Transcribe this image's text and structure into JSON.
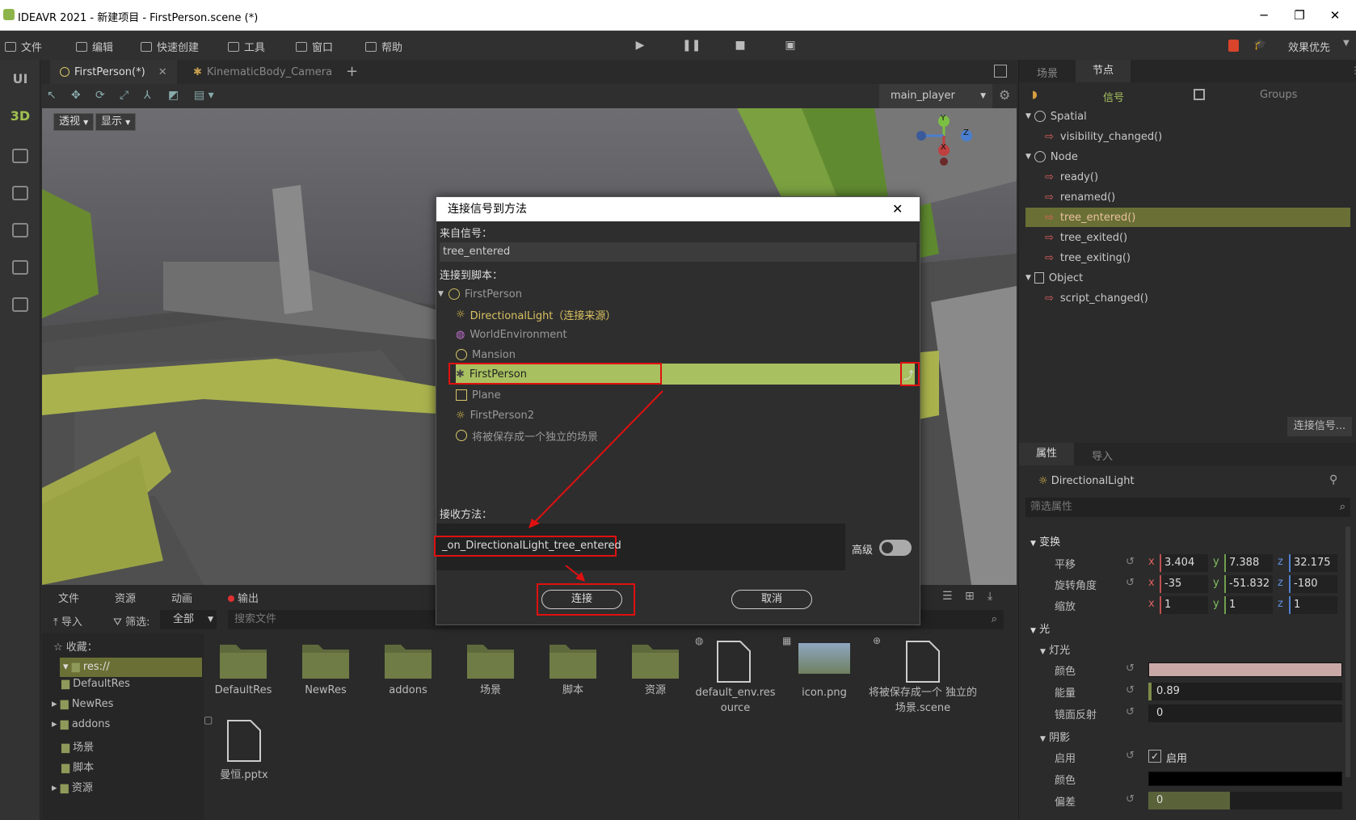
{
  "window": {
    "title": "IDEAVR 2021 - 新建项目 - FirstPerson.scene (*)",
    "controls": [
      "─",
      "❐",
      "✕"
    ]
  },
  "menubar": {
    "items": [
      "文件",
      "编辑",
      "快速创建",
      "工具",
      "窗口",
      "帮助"
    ],
    "perf_label": "效果优先"
  },
  "leftbar": {
    "ui_label": "UI",
    "d3_label": "3D"
  },
  "tabs": [
    {
      "label": "FirstPerson(*)",
      "close": "✕"
    },
    {
      "label": "KinematicBody_Camera"
    }
  ],
  "tabs_add": "+",
  "toolbar3d": {
    "camera_select": "main_player"
  },
  "viewport": {
    "view_btn": "透视",
    "show_btn": "显示",
    "gizmo": {
      "y": "Y",
      "z": "Z",
      "x": "X"
    }
  },
  "bottom_dock": {
    "tabs": [
      "文件",
      "资源",
      "动画",
      "输出"
    ],
    "import_label": "导入",
    "filter_label": "筛选:",
    "filter_value": "全部",
    "search_placeholder": "搜索文件",
    "favorites_label": "收藏：",
    "tree": [
      "res://",
      "DefaultRes",
      "NewRes",
      "addons",
      "场景",
      "脚本",
      "资源"
    ],
    "files": [
      {
        "label": "DefaultRes",
        "kind": "folder"
      },
      {
        "label": "NewRes",
        "kind": "folder"
      },
      {
        "label": "addons",
        "kind": "folder"
      },
      {
        "label": "场景",
        "kind": "folder"
      },
      {
        "label": "脚本",
        "kind": "folder"
      },
      {
        "label": "资源",
        "kind": "folder"
      },
      {
        "label": "default_env.res ource",
        "kind": "file"
      },
      {
        "label": "icon.png",
        "kind": "image"
      },
      {
        "label": "将被保存成一个 独立的场景.scene",
        "kind": "file"
      },
      {
        "label": "曼恒.pptx",
        "kind": "file"
      }
    ]
  },
  "right_panel": {
    "top_tabs": [
      "场景",
      "节点"
    ],
    "sub_tabs": {
      "signals": "信号",
      "groups": "Groups"
    },
    "signal_tree": [
      {
        "label": "Spatial",
        "type": "class"
      },
      {
        "label": "visibility_changed()",
        "type": "signal"
      },
      {
        "label": "Node",
        "type": "class"
      },
      {
        "label": "ready()",
        "type": "signal"
      },
      {
        "label": "renamed()",
        "type": "signal"
      },
      {
        "label": "tree_entered()",
        "type": "signal",
        "selected": true
      },
      {
        "label": "tree_exited()",
        "type": "signal"
      },
      {
        "label": "tree_exiting()",
        "type": "signal"
      },
      {
        "label": "Object",
        "type": "class"
      },
      {
        "label": "script_changed()",
        "type": "signal"
      }
    ],
    "connect_signal_btn": "连接信号...",
    "prop_tabs": [
      "属性",
      "导入"
    ],
    "inspected_node": "DirectionalLight",
    "filter_placeholder": "筛选属性",
    "transform_section": "变换",
    "translation_label": "平移",
    "translation": {
      "x": "3.404",
      "y": "7.388",
      "z": "32.175"
    },
    "rotation_label": "旋转角度",
    "rotation": {
      "x": "-35",
      "y": "-51.832",
      "z": "-180"
    },
    "scale_label": "缩放",
    "scale": {
      "x": "1",
      "y": "1",
      "z": "1"
    },
    "light_section": "光",
    "light_sub": "灯光",
    "color_label": "颜色",
    "color_value": "#c9a9a6",
    "energy_label": "能量",
    "energy_value": "0.89",
    "specular_label": "镜面反射",
    "specular_value": "0",
    "shadow_section": "阴影",
    "shadow_enable_label": "启用",
    "shadow_enable_text": "启用",
    "shadow_color_label": "颜色",
    "shadow_bias_label": "偏差",
    "shadow_bias_value": "0",
    "axis": {
      "x": "x",
      "y": "y",
      "z": "z"
    }
  },
  "dialog": {
    "title": "连接信号到方法",
    "close": "✕",
    "from_signal_label": "来自信号：",
    "from_signal_value": "tree_entered",
    "to_script_label": "连接到脚本：",
    "tree": [
      {
        "label": "FirstPerson",
        "icon": "spatial",
        "depth": 0,
        "dim": true
      },
      {
        "label": "DirectionalLight（连接来源）",
        "icon": "light",
        "depth": 1,
        "source": true
      },
      {
        "label": "WorldEnvironment",
        "icon": "globe",
        "depth": 1,
        "dim": true
      },
      {
        "label": "Mansion",
        "icon": "spatial",
        "depth": 1,
        "dim": true
      },
      {
        "label": "FirstPerson",
        "icon": "kinematic",
        "depth": 1,
        "selected": true
      },
      {
        "label": "Plane",
        "icon": "mesh",
        "depth": 1,
        "dim": true
      },
      {
        "label": "FirstPerson2",
        "icon": "light",
        "depth": 1,
        "dim": true
      },
      {
        "label": "将被保存成一个独立的场景",
        "icon": "spatial",
        "depth": 1,
        "dim": true
      }
    ],
    "method_label": "接收方法：",
    "method_value": "_on_DirectionalLight_tree_entered",
    "advanced_label": "高级",
    "connect_btn": "连接",
    "cancel_btn": "取消"
  }
}
